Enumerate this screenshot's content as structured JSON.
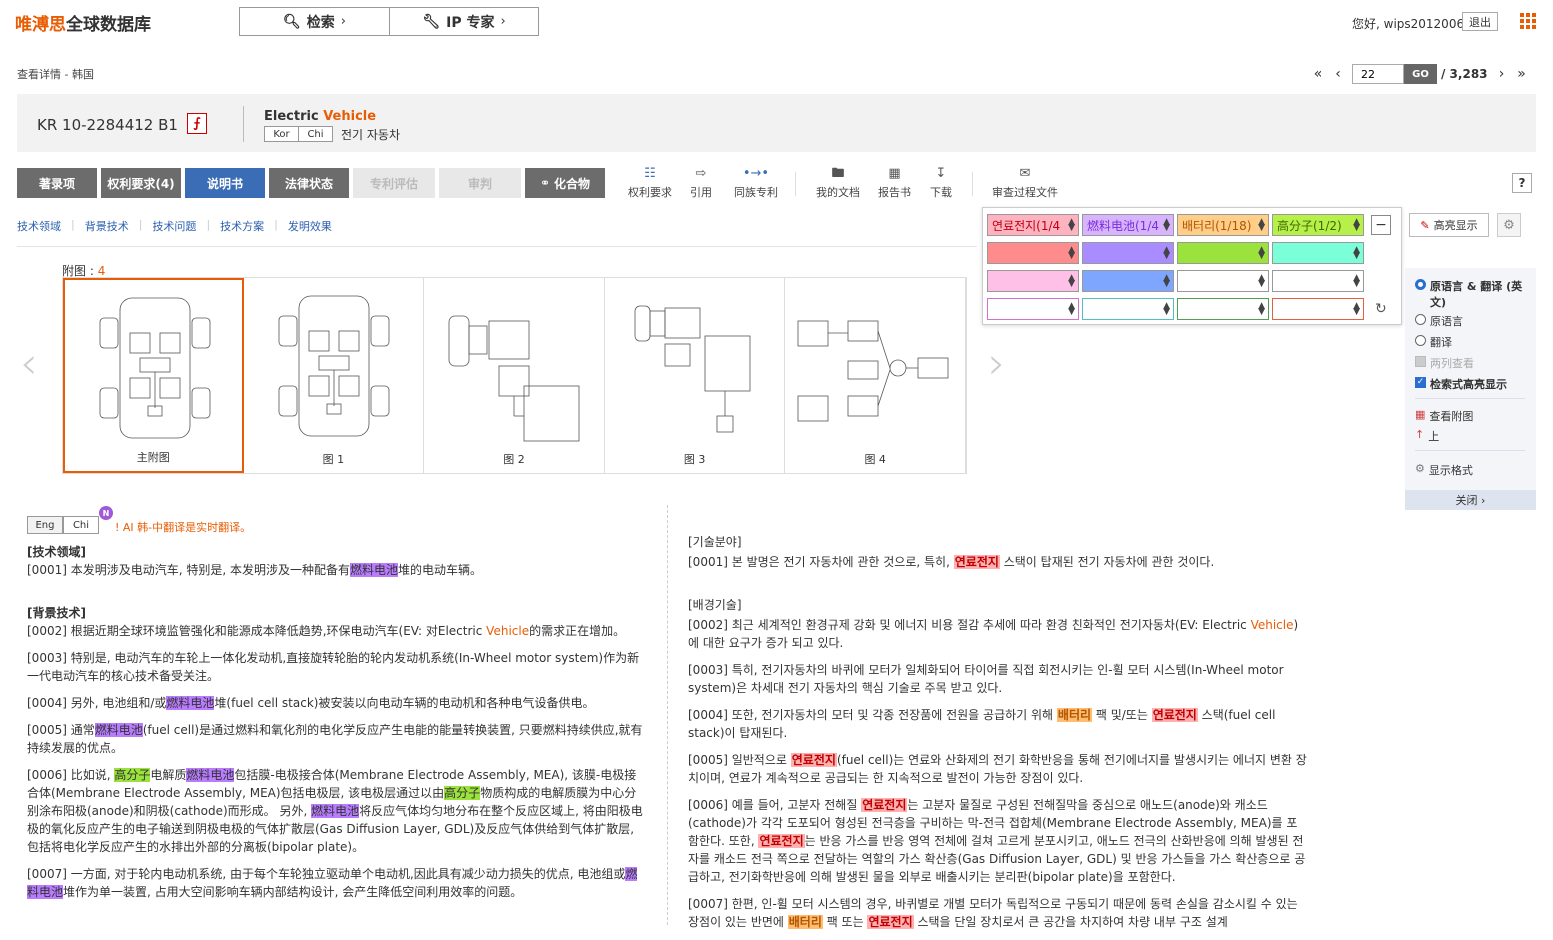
{
  "header": {
    "logo_brand": "唯溥思",
    "logo_rest": "全球数据库",
    "search_btn": "检索",
    "ip_btn": "IP 专家",
    "greeting": "您好, wips2012006",
    "logout": "退出"
  },
  "breadcrumb": "查看详情 - 韩国",
  "pager": {
    "first": "«",
    "prev": "‹",
    "current": "22",
    "go": "GO",
    "total": "/ 3,283",
    "next": "›",
    "last": "»"
  },
  "doc": {
    "number": "KR 10-2284412 B1",
    "pdf_icon": "pdf-icon",
    "en_title_a": "Electric ",
    "en_title_b": "Vehicle",
    "lang_kor": "Kor",
    "lang_chi": "Chi",
    "ko_title": "전기 자동차"
  },
  "tabs": [
    {
      "label": "著录项"
    },
    {
      "label": "权利要求(4)"
    },
    {
      "label": "说明书"
    },
    {
      "label": "法律状态"
    },
    {
      "label": "专利评估"
    },
    {
      "label": "审判"
    },
    {
      "label": "化合物"
    }
  ],
  "tools": [
    {
      "label": "权利要求",
      "icon": "tree-icon"
    },
    {
      "label": "引用",
      "icon": "cite-icon"
    },
    {
      "label": "同族专利",
      "icon": "family-icon"
    },
    {
      "label": "我的文档",
      "icon": "folder-icon"
    },
    {
      "label": "报告书",
      "icon": "report-icon"
    },
    {
      "label": "下载",
      "icon": "download-icon"
    },
    {
      "label": "审查过程文件",
      "icon": "mail-icon"
    }
  ],
  "help": "?",
  "anchors": [
    "技术领域",
    "背景技术",
    "技术问题",
    "技术方案",
    "发明效果"
  ],
  "figures": {
    "label": "附图 : ",
    "count": "4",
    "items": [
      {
        "caption": "主附图"
      },
      {
        "caption": "图 1"
      },
      {
        "caption": "图 2"
      },
      {
        "caption": "图 3"
      },
      {
        "caption": "图 4"
      }
    ]
  },
  "highlight": {
    "terms": [
      {
        "label": "연료전지(1/4",
        "color": "#ffb3c1"
      },
      {
        "label": "燃料电池(1/4",
        "color": "#d8b4ff"
      },
      {
        "label": "배터리(1/18)",
        "color": "#ffcf8a"
      },
      {
        "label": "高分子(1/2)",
        "color": "#b8f04a"
      }
    ],
    "row2_colors": [
      "#ff8c8c",
      "#a98cff",
      "#9be23c",
      "#7affd8"
    ],
    "row3_colors": [
      "#ffc0e8",
      "#7ea6ff",
      "#ffffff",
      "#ffffff"
    ],
    "button": "高亮显示"
  },
  "options": {
    "radio1": "原语言 & 翻译 (英文)",
    "radio2": "原语言",
    "radio3": "翻译",
    "check1": "两列查看",
    "check2": "检索式高亮显示",
    "link1": "查看附图",
    "link2": "上",
    "link3": "显示格式",
    "close": "关闭 ›"
  },
  "lang_switch": {
    "eng": "Eng",
    "chi": "Chi",
    "badge": "N",
    "note": "! AI 韩-中翻译是实时翻译。"
  },
  "left": {
    "h_field": "[技术领域]",
    "p1a": "[0001] 本发明涉及电动汽车, 特别是, 本发明涉及一种配备有",
    "p1h": "燃料电池",
    "p1b": "堆的电动车辆。",
    "h_bg": "[背景技术]",
    "p2a": "[0002] 根据近期全球环境监管强化和能源成本降低趋势,环保电动汽车(EV: 对Electric ",
    "p2o": "Vehicle",
    "p2b": "的需求正在增加。",
    "p3": "[0003] 特别是, 电动汽车的车轮上一体化发动机,直接旋转轮胎的轮内发动机系统(In-Wheel motor system)作为新一代电动汽车的核心技术备受关注。",
    "p4a": "[0004] 另外, 电池组和/或",
    "p4h": "燃料电池",
    "p4b": "堆(fuel cell stack)被安装以向电动车辆的电动机和各种电气设备供电。",
    "p5a": "[0005] 通常",
    "p5h": "燃料电池",
    "p5b": "(fuel cell)是通过燃料和氧化剂的电化学反应产生电能的能量转换装置, 只要燃料持续供应,就有持续发展的优点。",
    "p6a": "[0006] 比如说, ",
    "p6h1": "高分子",
    "p6b": "电解质",
    "p6h2": "燃料电池",
    "p6c": "包括膜-电极接合体(Membrane Electrode Assembly, MEA), 该膜-电极接合体(Membrane Electrode Assembly, MEA)包括电极层, 该电极层通过以由",
    "p6h3": "高分子",
    "p6d": "物质构成的电解质膜为中心分别涂布阳极(anode)和阴极(cathode)而形成。 另外, ",
    "p6h4": "燃料电池",
    "p6e": "将反应气体均匀地分布在整个反应区域上, 将由阳极电极的氧化反应产生的电子输送到阴极电极的气体扩散层(Gas Diffusion Layer, GDL)及反应气体供给到气体扩散层, 包括将电化学反应产生的水排出外部的分离板(bipolar plate)。",
    "p7a": "[0007] 一方面, 对于轮内电动机系统, 由于每个车轮独立驱动单个电动机,因此具有减少动力损失的优点, 电池组或",
    "p7h": "燃料电池",
    "p7b": "堆作为单一装置, 占用大空间影响车辆内部结构设计, 会产生降低空间利用效率的问题。"
  },
  "right": {
    "h_field": "[기술분야]",
    "p1a": "[0001] 본 발명은 전기 자동차에 관한 것으로, 특히, ",
    "p1h": "연료전지",
    "p1b": " 스택이 탑재된 전기 자동차에 관한 것이다.",
    "h_bg": "[배경기술]",
    "p2a": "[0002] 최근 세계적인 환경규제 강화 및 에너지 비용 절감 추세에 따라 환경 친화적인 전기자동차(EV: Electric ",
    "p2o": "Vehicle",
    "p2b": ")에 대한 요구가 증가 되고 있다.",
    "p3": "[0003] 특히, 전기자동차의 바퀴에 모터가 일체화되어 타이어를 직접 회전시키는 인-휠 모터 시스템(In-Wheel motor system)은 차세대 전기 자동차의 핵심 기술로 주목 받고 있다.",
    "p4a": "[0004] 또한, 전기자동차의 모터 및 각종 전장품에 전원을 공급하기 위해 ",
    "p4h1": "배터리",
    "p4b": " 팩 및/또는 ",
    "p4h2": "연료전지",
    "p4c": " 스택(fuel cell stack)이 탑재된다.",
    "p5a": "[0005] 일반적으로 ",
    "p5h": "연료전지",
    "p5b": "(fuel cell)는 연료와 산화제의 전기 화학반응을 통해 전기에너지를 발생시키는 에너지 변환 장치이며, 연료가 계속적으로 공급되는 한 지속적으로 발전이 가능한 장점이 있다.",
    "p6a": "[0006] 예를 들어, 고분자 전해질 ",
    "p6h1": "연료전지",
    "p6b": "는 고분자 물질로 구성된 전해질막을 중심으로 애노드(anode)와 캐소드(cathode)가 각각 도포되어 형성된 전극층을 구비하는 막-전극 접합체(Membrane Electrode Assembly, MEA)를 포함한다. 또한, ",
    "p6h2": "연료전지",
    "p6c": "는 반응 가스를 반응 영역 전체에 걸쳐 고르게 분포시키고, 애노드 전극의 산화반응에 의해 발생된 전자를 캐소드 전극 쪽으로 전달하는 역할의 가스 확산층(Gas Diffusion Layer, GDL) 및 반응 가스들을 가스 확산층으로 공급하고, 전기화학반응에 의해 발생된 물을 외부로 배출시키는 분리판(bipolar plate)을 포함한다.",
    "p7a": "[0007] 한편, 인-휠 모터 시스템의 경우, 바퀴별로 개별 모터가 독립적으로 구동되기 때문에 동력 손실을 감소시킬 수 있는 장점이 있는 반면에 ",
    "p7h1": "배터리",
    "p7b": " 팩 또는 ",
    "p7h2": "연료전지",
    "p7c": " 스택을 단일 장치로서 큰 공간을 차지하여 차량 내부 구조 설계"
  }
}
